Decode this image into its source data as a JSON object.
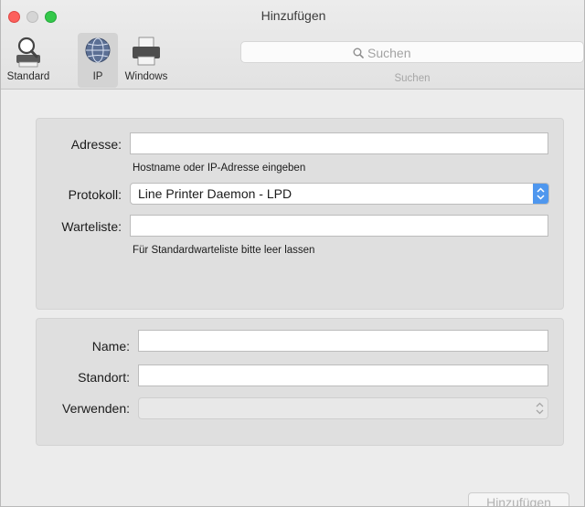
{
  "window": {
    "title": "Hinzufügen"
  },
  "toolbar": {
    "tools": [
      {
        "label": "Standard",
        "icon": "magnifier-printer-icon"
      },
      {
        "label": "IP",
        "icon": "globe-icon"
      },
      {
        "label": "Windows",
        "icon": "printer-icon"
      }
    ],
    "search": {
      "placeholder": "Suchen",
      "caption": "Suchen"
    }
  },
  "form": {
    "address_label": "Adresse:",
    "address_value": "",
    "address_hint": "Hostname oder IP-Adresse eingeben",
    "protocol_label": "Protokoll:",
    "protocol_value": "Line Printer Daemon - LPD",
    "queue_label": "Warteliste:",
    "queue_value": "",
    "queue_hint": "Für Standardwarteliste bitte leer lassen",
    "name_label": "Name:",
    "name_value": "",
    "location_label": "Standort:",
    "location_value": "",
    "use_label": "Verwenden:",
    "use_value": ""
  },
  "footer": {
    "add_button": "Hinzufügen"
  },
  "colors": {
    "accent": "#4f97ee",
    "close": "#fc605c",
    "zoom": "#34c84a"
  }
}
